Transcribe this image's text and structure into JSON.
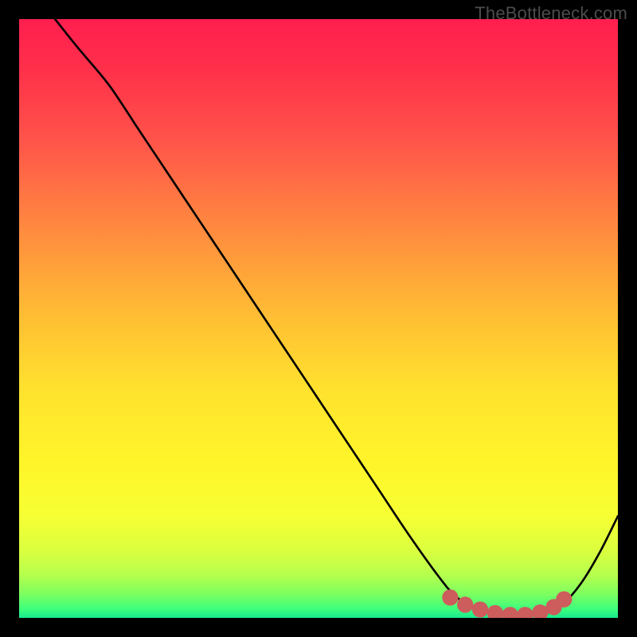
{
  "watermark": "TheBottleneck.com",
  "colors": {
    "background": "#000000",
    "gradient_stops": [
      {
        "offset": 0.0,
        "color": "#ff1f4f"
      },
      {
        "offset": 0.08,
        "color": "#ff2f4a"
      },
      {
        "offset": 0.2,
        "color": "#ff534a"
      },
      {
        "offset": 0.35,
        "color": "#ff8a3f"
      },
      {
        "offset": 0.5,
        "color": "#ffbf33"
      },
      {
        "offset": 0.62,
        "color": "#ffe22e"
      },
      {
        "offset": 0.74,
        "color": "#fff52a"
      },
      {
        "offset": 0.83,
        "color": "#f6ff33"
      },
      {
        "offset": 0.89,
        "color": "#d9ff3f"
      },
      {
        "offset": 0.93,
        "color": "#b3ff4e"
      },
      {
        "offset": 0.96,
        "color": "#7dff60"
      },
      {
        "offset": 0.985,
        "color": "#3eff7c"
      },
      {
        "offset": 1.0,
        "color": "#18e88f"
      }
    ],
    "curve": "#000000",
    "dots": "#cd5c5c"
  },
  "chart_data": {
    "type": "line",
    "title": "",
    "xlabel": "",
    "ylabel": "",
    "xlim": [
      0,
      100
    ],
    "ylim": [
      0,
      100
    ],
    "grid": false,
    "legend": false,
    "series": [
      {
        "name": "bottleneck-curve",
        "x": [
          6,
          10,
          15,
          20,
          25,
          30,
          35,
          40,
          45,
          50,
          55,
          60,
          65,
          70,
          73,
          76,
          79,
          82,
          85,
          88,
          91,
          94,
          97,
          100
        ],
        "y": [
          100,
          95,
          89,
          81.5,
          74,
          66.5,
          59,
          51.5,
          44,
          36.5,
          29,
          21.5,
          14,
          7,
          3.5,
          1.8,
          0.8,
          0.4,
          0.4,
          0.8,
          2.5,
          6,
          11,
          17
        ]
      }
    ],
    "annotations": {
      "optimal_dots": {
        "name": "optimal-range-dots",
        "x": [
          72,
          74.5,
          77,
          79.5,
          82,
          84.5,
          87,
          89.3,
          91
        ],
        "y": [
          3.4,
          2.2,
          1.4,
          0.8,
          0.5,
          0.5,
          0.9,
          1.8,
          3.1
        ]
      }
    }
  }
}
